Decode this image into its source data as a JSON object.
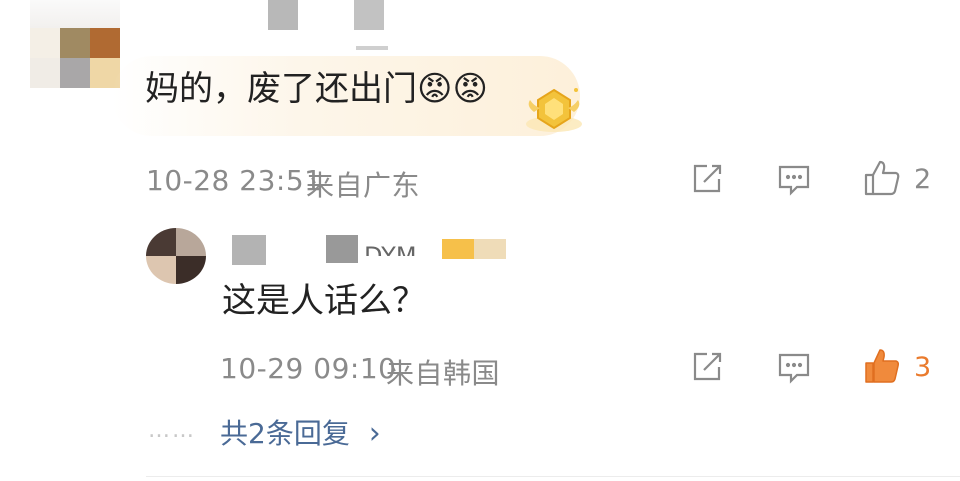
{
  "comment": {
    "text": "妈的，废了还出门😡😡",
    "time": "10-28 23:51",
    "location": "来自广东",
    "like_count": "2"
  },
  "reply": {
    "username_fragment": "_DYM",
    "text": "这是人话么？",
    "time": "10-29 09:10",
    "location": "来自韩国",
    "like_count": "3"
  },
  "more_replies": {
    "dots": "……",
    "label": "共2条回复",
    "chevron": "›"
  },
  "icons": {
    "share": "share-icon",
    "comment": "comment-icon",
    "like": "thumbs-up-icon",
    "badge": "gold-badge-icon"
  },
  "colors": {
    "meta_gray": "#8a8a8a",
    "link_blue": "#4a6a96",
    "like_active": "#ea7b2d"
  }
}
